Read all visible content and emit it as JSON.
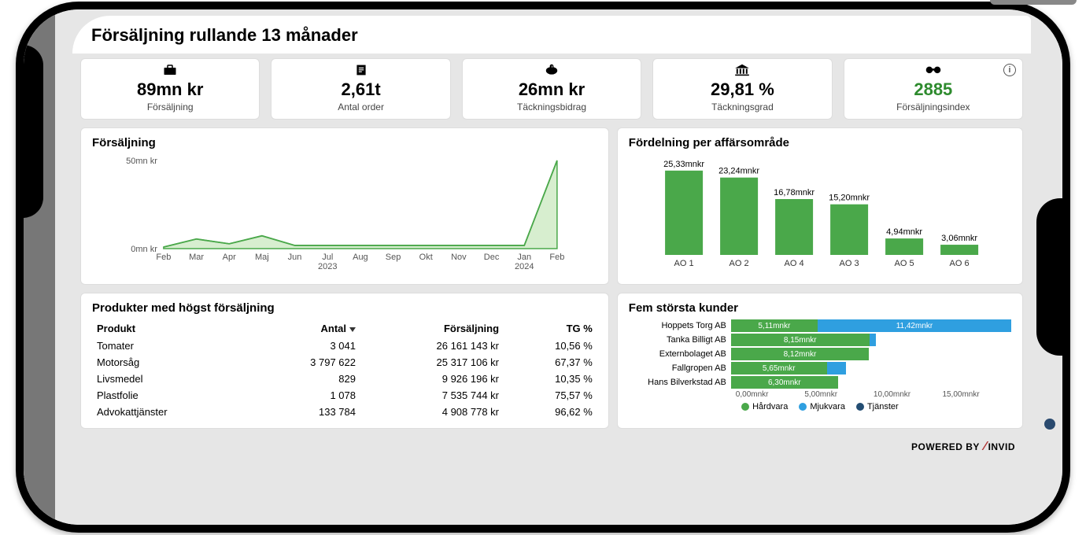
{
  "page_title": "Försäljning rullande 13 månader",
  "kpis": [
    {
      "icon": "briefcase",
      "value": "89mn kr",
      "label": "Försäljning"
    },
    {
      "icon": "document",
      "value": "2,61t",
      "label": "Antal order"
    },
    {
      "icon": "piggy",
      "value": "26mn kr",
      "label": "Täckningsbidrag"
    },
    {
      "icon": "bank",
      "value": "29,81 %",
      "label": "Täckningsgrad"
    },
    {
      "icon": "binoc",
      "value": "2885",
      "label": "Försäljningsindex",
      "green": true,
      "info": true
    }
  ],
  "line_card_title": "Försäljning",
  "bar_card_title": "Fördelning per affärsområde",
  "table_card_title": "Produkter med högst försäljning",
  "cust_card_title": "Fem största kunder",
  "table_headers": {
    "col1": "Produkt",
    "col2": "Antal",
    "col3": "Försäljning",
    "col4": "TG %"
  },
  "table_rows": [
    {
      "produkt": "Tomater",
      "antal": "3 041",
      "fors": "26 161 143 kr",
      "tg": "10,56 %"
    },
    {
      "produkt": "Motorsåg",
      "antal": "3 797 622",
      "fors": "25 317 106 kr",
      "tg": "67,37 %"
    },
    {
      "produkt": "Livsmedel",
      "antal": "829",
      "fors": "9 926 196 kr",
      "tg": "10,35 %"
    },
    {
      "produkt": "Plastfolie",
      "antal": "1 078",
      "fors": "7 535 744 kr",
      "tg": "75,57 %"
    },
    {
      "produkt": "Advokattjänster",
      "antal": "133 784",
      "fors": "4 908 778 kr",
      "tg": "96,62 %"
    }
  ],
  "customers_axis": [
    "0,00mnkr",
    "5,00mnkr",
    "10,00mnkr",
    "15,00mnkr"
  ],
  "legend_labels": {
    "g": "Hårdvara",
    "b": "Mjukvara",
    "d": "Tjänster"
  },
  "footer": {
    "prefix": "POWERED BY",
    "brand": "INVID"
  },
  "chart_data": [
    {
      "type": "area",
      "title": "Försäljning",
      "ylabel": "",
      "xlabel": "",
      "ylim": [
        0,
        55
      ],
      "y_unit": "mn kr",
      "y_ticks": [
        0,
        50
      ],
      "categories": [
        "Feb",
        "Mar",
        "Apr",
        "Maj",
        "Jun",
        "Jul",
        "Aug",
        "Sep",
        "Okt",
        "Nov",
        "Dec",
        "Jan",
        "Feb"
      ],
      "category_sub": [
        "",
        "",
        "",
        "",
        "",
        "2023",
        "",
        "",
        "",
        "",
        "",
        "2024",
        ""
      ],
      "values": [
        1,
        6,
        3,
        8,
        2,
        2,
        2,
        2,
        2,
        2,
        2,
        2,
        55
      ]
    },
    {
      "type": "bar",
      "title": "Fördelning per affärsområde",
      "y_unit": "mnkr",
      "ylim": [
        0,
        26
      ],
      "categories": [
        "AO 1",
        "AO 2",
        "AO 4",
        "AO 3",
        "AO 5",
        "AO 6"
      ],
      "values": [
        25.33,
        23.24,
        16.78,
        15.2,
        4.94,
        3.06
      ],
      "value_labels": [
        "25,33mnkr",
        "23,24mnkr",
        "16,78mnkr",
        "15,20mnkr",
        "4,94mnkr",
        "3,06mnkr"
      ]
    },
    {
      "type": "bar",
      "orientation": "horizontal-stacked",
      "title": "Fem största kunder",
      "x_unit": "mnkr",
      "xlim": [
        0,
        16.5
      ],
      "categories": [
        "Hoppets Torg AB",
        "Tanka Billigt AB",
        "Externbolaget AB",
        "Fallgropen AB",
        "Hans Bilverkstad AB"
      ],
      "series": [
        {
          "name": "Hårdvara",
          "color": "#4aa84a",
          "values": [
            5.11,
            8.15,
            8.12,
            5.65,
            6.3
          ]
        },
        {
          "name": "Mjukvara",
          "color": "#2f9fe0",
          "values": [
            11.42,
            0.4,
            0.0,
            1.1,
            0.0
          ]
        },
        {
          "name": "Tjänster",
          "color": "#234d73",
          "values": [
            0.0,
            0.0,
            0.0,
            0.0,
            0.0
          ]
        }
      ],
      "value_labels": {
        "Hårdvara": [
          "5,11mnkr",
          "8,15mnkr",
          "8,12mnkr",
          "5,65mnkr",
          "6,30mnkr"
        ],
        "Mjukvara": [
          "11,42mnkr",
          "",
          "",
          "",
          ""
        ]
      }
    }
  ]
}
